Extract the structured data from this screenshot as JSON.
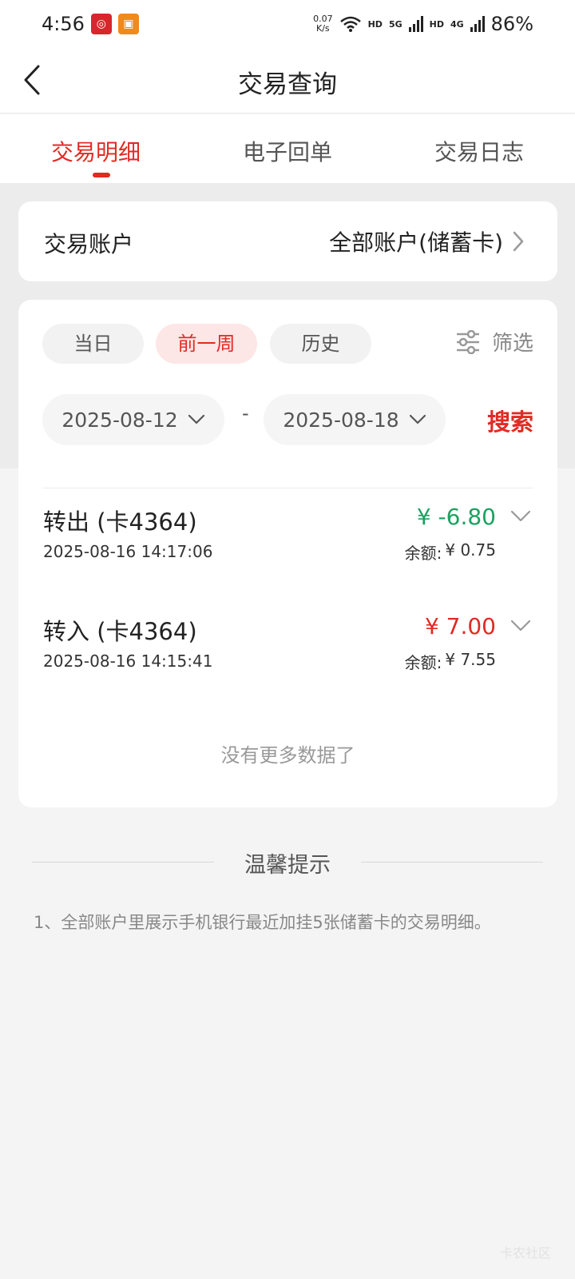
{
  "status_bar": {
    "time": "4:56",
    "net_speed_value": "0.07",
    "net_speed_unit": "K/s",
    "hd1": "HD",
    "sig1": "5G",
    "hd2": "HD",
    "sig2": "4G",
    "battery": "86%"
  },
  "nav": {
    "title": "交易查询"
  },
  "tabs": [
    {
      "label": "交易明细",
      "active": true
    },
    {
      "label": "电子回单",
      "active": false
    },
    {
      "label": "交易日志",
      "active": false
    }
  ],
  "account": {
    "label": "交易账户",
    "value": "全部账户(储蓄卡)"
  },
  "query": {
    "chips": [
      {
        "label": "当日",
        "active": false
      },
      {
        "label": "前一周",
        "active": true
      },
      {
        "label": "历史",
        "active": false
      }
    ],
    "filter_label": "筛选",
    "start_date": "2025-08-12",
    "date_separator": "-",
    "end_date": "2025-08-18",
    "search_label": "搜索"
  },
  "transactions": [
    {
      "title": "转出 (卡4364)",
      "time": "2025-08-16 14:17:06",
      "amount": "¥ -6.80",
      "direction": "out",
      "balance_label": "余额:",
      "balance": "¥ 0.75"
    },
    {
      "title": "转入 (卡4364)",
      "time": "2025-08-16 14:15:41",
      "amount": "¥ 7.00",
      "direction": "in",
      "balance_label": "余额:",
      "balance": "¥ 7.55"
    }
  ],
  "no_more_text": "没有更多数据了",
  "tips": {
    "title": "温馨提示",
    "text": "1、全部账户里展示手机银行最近加挂5张储蓄卡的交易明细。"
  },
  "watermark": "卡农社区",
  "colors": {
    "accent": "#e02b24",
    "outflow": "#1aa260",
    "background": "#f4f4f4"
  }
}
